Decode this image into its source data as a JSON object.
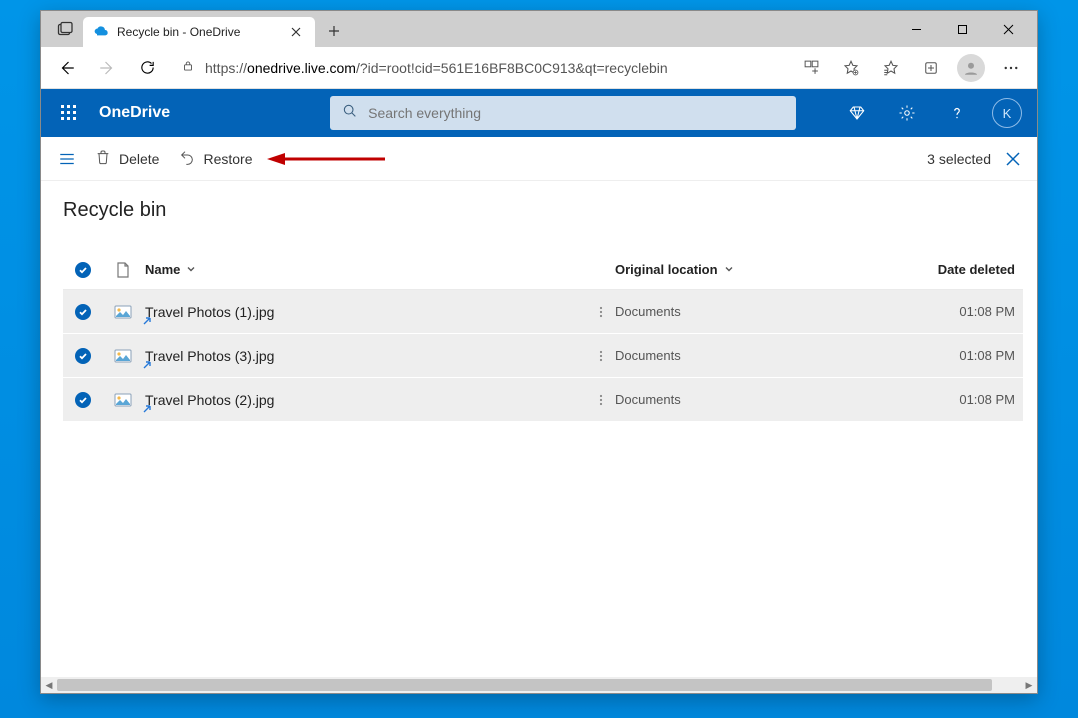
{
  "browser": {
    "tab_title": "Recycle bin - OneDrive",
    "url_scheme": "https://",
    "url_host": "onedrive.live.com",
    "url_path": "/?id=root!cid=561E16BF8BC0C913&qt=recyclebin"
  },
  "onedrive": {
    "brand": "OneDrive",
    "search_placeholder": "Search everything",
    "avatar_initial": "K"
  },
  "commandbar": {
    "delete": "Delete",
    "restore": "Restore",
    "selection_text": "3 selected"
  },
  "page": {
    "title": "Recycle bin",
    "columns": {
      "name": "Name",
      "location": "Original location",
      "date": "Date deleted"
    },
    "rows": [
      {
        "name": "Travel Photos (1).jpg",
        "location": "Documents",
        "date": "01:08 PM"
      },
      {
        "name": "Travel Photos (3).jpg",
        "location": "Documents",
        "date": "01:08 PM"
      },
      {
        "name": "Travel Photos (2).jpg",
        "location": "Documents",
        "date": "01:08 PM"
      }
    ]
  }
}
